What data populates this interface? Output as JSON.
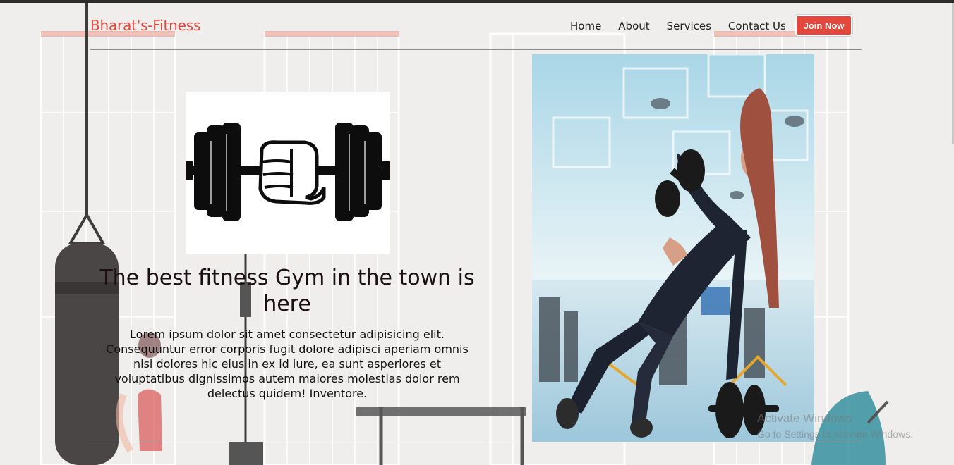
{
  "header": {
    "brand": "Bharat's-Fitness",
    "nav": [
      "Home",
      "About",
      "Services",
      "Contact Us"
    ],
    "cta": "Join Now"
  },
  "hero": {
    "headline": "The best fitness Gym in the town is here",
    "paragraph": "Lorem ipsum dolor sit amet consectetur adipisicing elit. Consequuntur error corporis fugit dolore adipisci aperiam omnis nisi dolores hic eius in ex id iure, ea sunt asperiores et voluptatibus dignissimos autem maiores molestias dolor rem delectus quidem! Inventore."
  },
  "watermark": {
    "line1": "Activate Windows",
    "line2": "Go to Settings to activate Windows."
  },
  "icons": {
    "logo": "dumbbell-fist-icon"
  },
  "colors": {
    "brand": "#e4473b",
    "text": "#222222",
    "background": "#efeeed"
  }
}
